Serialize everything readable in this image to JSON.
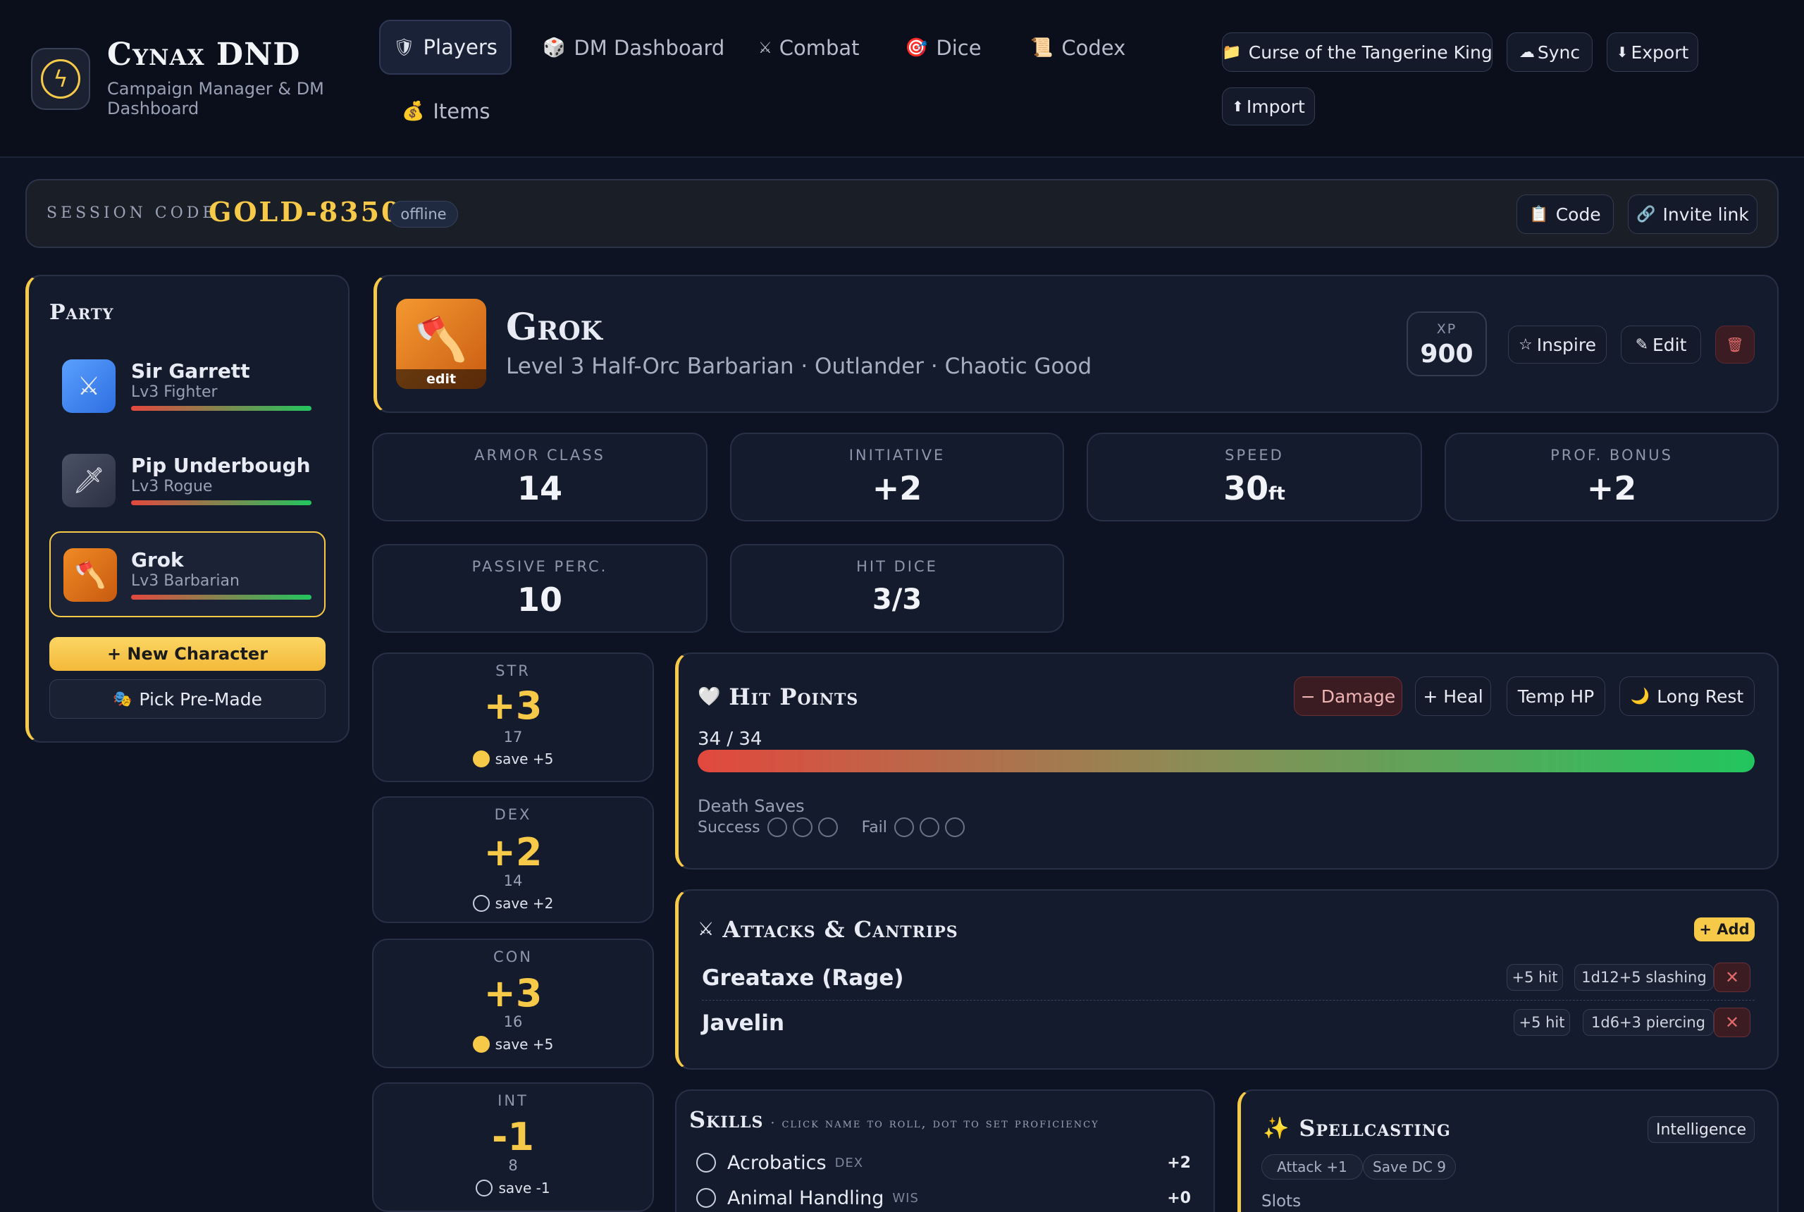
{
  "app": {
    "title": "Cynax DND",
    "subtitle_line1": "Campaign Manager & DM",
    "subtitle_line2": "Dashboard",
    "logo_icon": "lightning-icon"
  },
  "nav": {
    "tabs": [
      {
        "icon": "🛡",
        "label": "Players",
        "active": true
      },
      {
        "icon": "🎲",
        "label": "DM Dashboard"
      },
      {
        "icon": "⚔",
        "label": "Combat"
      },
      {
        "icon": "🎯",
        "label": "Dice"
      },
      {
        "icon": "📜",
        "label": "Codex"
      },
      {
        "icon": "💰",
        "label": "Items"
      }
    ]
  },
  "toolbar": {
    "campaign": {
      "icon": "📁",
      "label": "Curse of the Tangerine King"
    },
    "sync": {
      "icon": "☁",
      "label": "Sync"
    },
    "export": {
      "icon": "⬇",
      "label": "Export"
    },
    "import": {
      "icon": "⬆",
      "label": "Import"
    }
  },
  "session": {
    "label": "SESSION CODE",
    "code": "GOLD-8350",
    "status": "offline",
    "code_btn": {
      "icon": "📋",
      "label": "Code"
    },
    "invite_btn": {
      "icon": "🔗",
      "label": "Invite link"
    }
  },
  "party": {
    "heading": "Party",
    "members": [
      {
        "name": "Sir Garrett",
        "sub": "Lv3 Fighter",
        "icon": "⚔",
        "hp_fraction": 1.0,
        "selected": false
      },
      {
        "name": "Pip Underbough",
        "sub": "Lv3 Rogue",
        "icon": "🗡",
        "hp_fraction": 1.0,
        "selected": false
      },
      {
        "name": "Grok",
        "sub": "Lv3 Barbarian",
        "icon": "🪓",
        "hp_fraction": 1.0,
        "selected": true
      }
    ],
    "new_character": "+ New Character",
    "pick_premade": {
      "icon": "🎭",
      "label": "Pick Pre-Made"
    }
  },
  "character": {
    "name": "Grok",
    "portrait_icon": "🪓",
    "portrait_edit": "edit",
    "description": "Level 3 Half-Orc Barbarian · Outlander · Chaotic Good",
    "xp_label": "XP",
    "xp": "900",
    "inspire": {
      "icon": "☆",
      "label": "Inspire"
    },
    "edit": {
      "icon": "✎",
      "label": "Edit"
    },
    "delete_icon": "🗑"
  },
  "stats": {
    "ac": {
      "label": "ARMOR CLASS",
      "value": "14"
    },
    "initiative": {
      "label": "INITIATIVE",
      "value": "+2"
    },
    "speed": {
      "label": "SPEED",
      "value": "30",
      "unit": "ft"
    },
    "prof": {
      "label": "PROF. BONUS",
      "value": "+2"
    },
    "passive": {
      "label": "PASSIVE PERC.",
      "value": "10"
    },
    "hitdice": {
      "label": "HIT DICE",
      "value": "3/3"
    }
  },
  "abilities": [
    {
      "label": "STR",
      "mod": "+3",
      "score": "17",
      "save": "save +5",
      "proficient": true
    },
    {
      "label": "DEX",
      "mod": "+2",
      "score": "14",
      "save": "save +2",
      "proficient": false
    },
    {
      "label": "CON",
      "mod": "+3",
      "score": "16",
      "save": "save +5",
      "proficient": true
    },
    {
      "label": "INT",
      "mod": "-1",
      "score": "8",
      "save": "save -1",
      "proficient": false
    }
  ],
  "hp": {
    "heading": "Hit Points",
    "icon": "🤍",
    "current": 34,
    "max": 34,
    "text": "34 / 34",
    "damage": "− Damage",
    "heal": "+ Heal",
    "temp": "Temp HP",
    "long_rest": {
      "icon": "🌙",
      "label": "Long Rest"
    },
    "death_saves": "Death Saves",
    "success": "Success",
    "fail": "Fail"
  },
  "attacks": {
    "heading": "Attacks & Cantrips",
    "icon": "⚔",
    "add": "+ Add",
    "items": [
      {
        "name": "Greataxe (Rage)",
        "hit": "+5 hit",
        "damage": "1d12+5 slashing"
      },
      {
        "name": "Javelin",
        "hit": "+5 hit",
        "damage": "1d6+3 piercing"
      }
    ],
    "remove_icon": "✕"
  },
  "skills": {
    "heading": "Skills",
    "hint": "· click name to roll, dot to set proficiency",
    "items": [
      {
        "name": "Acrobatics",
        "ability": "DEX",
        "mod": "+2"
      },
      {
        "name": "Animal Handling",
        "ability": "WIS",
        "mod": "+0"
      }
    ]
  },
  "spellcasting": {
    "heading": "Spellcasting",
    "icon": "✨",
    "ability": "Intelligence",
    "attack": "Attack +1",
    "save_dc": "Save DC 9",
    "slots": "Slots"
  },
  "colors": {
    "accent": "#f7c948",
    "hp_start": "#e2483e",
    "hp_end": "#22c55e",
    "danger": "#3a1a1f"
  }
}
